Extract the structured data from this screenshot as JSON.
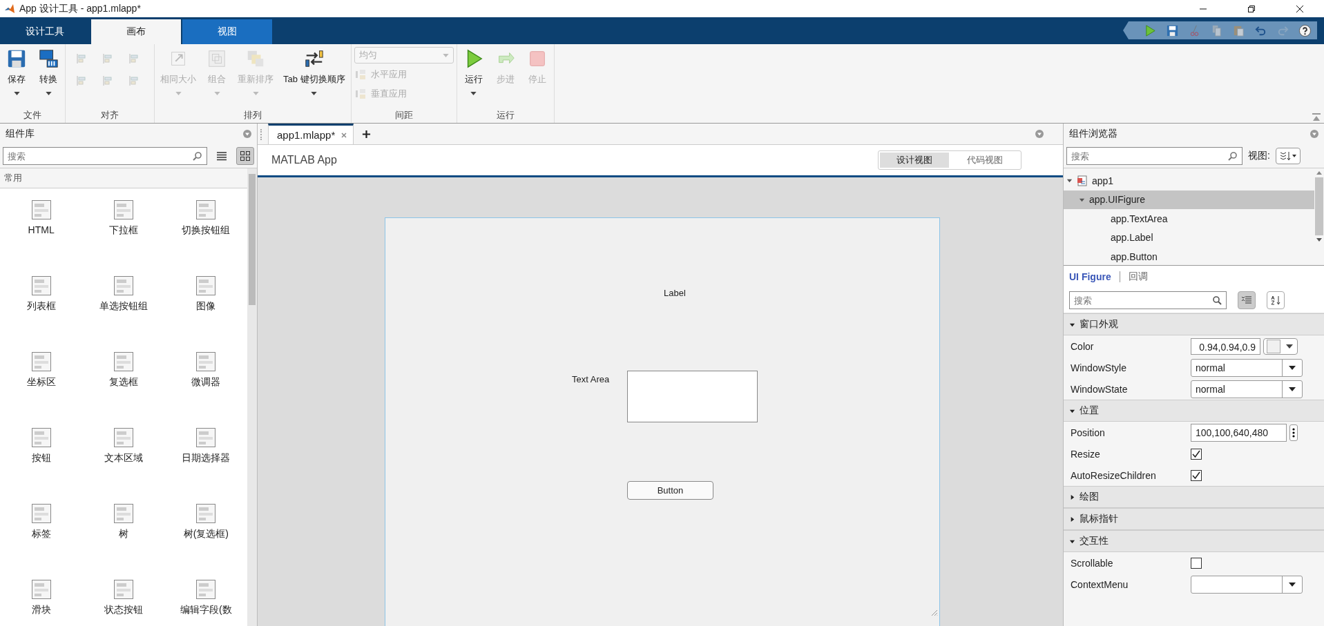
{
  "window": {
    "title": "App 设计工具 - app1.mlapp*"
  },
  "ribbon_tabs": [
    {
      "label": "设计工具",
      "selected": false
    },
    {
      "label": "画布",
      "selected": true
    },
    {
      "label": "视图",
      "selected": false
    }
  ],
  "ribbon_groups": [
    {
      "label": "文件",
      "items": [
        {
          "kind": "large",
          "label": "保存",
          "disabled": false,
          "dropdown": true
        },
        {
          "kind": "large",
          "label": "转换",
          "disabled": false,
          "dropdown": true
        }
      ]
    },
    {
      "label": "对齐",
      "items": [
        {
          "kind": "icon",
          "disabled": true
        },
        {
          "kind": "icon",
          "disabled": true
        },
        {
          "kind": "icon",
          "disabled": true
        },
        {
          "kind": "icon",
          "disabled": true
        },
        {
          "kind": "icon",
          "disabled": true
        },
        {
          "kind": "icon",
          "disabled": true
        }
      ]
    },
    {
      "label": "排列",
      "items": [
        {
          "kind": "large",
          "label": "相同大小",
          "disabled": true,
          "dropdown": true
        },
        {
          "kind": "large",
          "label": "组合",
          "disabled": true,
          "dropdown": true
        },
        {
          "kind": "large",
          "label": "重新排序",
          "disabled": true,
          "dropdown": true
        },
        {
          "kind": "large",
          "label": "Tab 键切换顺序",
          "disabled": false,
          "dropdown": true
        }
      ]
    },
    {
      "label": "间距",
      "items": [
        {
          "kind": "select",
          "value": "均匀",
          "disabled": true
        },
        {
          "kind": "small",
          "label": "水平应用",
          "disabled": true
        },
        {
          "kind": "small",
          "label": "垂直应用",
          "disabled": true
        }
      ]
    },
    {
      "label": "运行",
      "items": [
        {
          "kind": "large",
          "label": "运行",
          "disabled": false,
          "dropdown": true
        },
        {
          "kind": "large",
          "label": "步进",
          "disabled": true,
          "dropdown": false
        },
        {
          "kind": "large",
          "label": "停止",
          "disabled": true,
          "dropdown": false
        }
      ]
    }
  ],
  "library": {
    "title": "组件库",
    "search": {
      "placeholder": "搜索"
    },
    "view_modes": [
      {
        "kind": "list",
        "selected": false
      },
      {
        "kind": "grid",
        "selected": true
      }
    ],
    "section": "常用",
    "components": [
      "HTML",
      "下拉框",
      "切换按钮组",
      "列表框",
      "单选按钮组",
      "图像",
      "坐标区",
      "复选框",
      "微调器",
      "按钮",
      "文本区域",
      "日期选择器",
      "标签",
      "树",
      "树(复选框)",
      "滑块",
      "状态按钮",
      "编辑字段(数"
    ]
  },
  "document_tabs": [
    {
      "label": "app1.mlapp*",
      "selected": true
    }
  ],
  "designer": {
    "title": "MATLAB App",
    "views": [
      {
        "label": "设计视图",
        "selected": true
      },
      {
        "label": "代码视图",
        "selected": false
      }
    ]
  },
  "canvas": {
    "components": [
      {
        "kind": "label",
        "text": "Label"
      },
      {
        "kind": "textarea",
        "label": "Text Area"
      },
      {
        "kind": "button",
        "text": "Button"
      }
    ]
  },
  "browser": {
    "title": "组件浏览器",
    "search": {
      "placeholder": "搜索"
    },
    "view_label": "视图:",
    "tree": [
      {
        "label": "app1",
        "expanded": true,
        "selected": false,
        "children": [
          {
            "label": "app.UIFigure",
            "expanded": true,
            "selected": true,
            "children": [
              {
                "label": "app.TextArea",
                "selected": false
              },
              {
                "label": "app.Label",
                "selected": false
              },
              {
                "label": "app.Button",
                "selected": false
              }
            ]
          }
        ]
      }
    ]
  },
  "inspector": {
    "tabs": [
      {
        "label": "UI Figure",
        "selected": true
      },
      {
        "label": "回调",
        "selected": false
      }
    ],
    "search": {
      "placeholder": "搜索"
    },
    "sections": [
      {
        "title": "窗口外观",
        "expanded": true,
        "properties": [
          {
            "name": "Color",
            "kind": "color",
            "value": "0.94,0.94,0.9"
          },
          {
            "name": "WindowStyle",
            "kind": "dropdown",
            "value": "normal"
          },
          {
            "name": "WindowState",
            "kind": "dropdown",
            "value": "normal"
          }
        ]
      },
      {
        "title": "位置",
        "expanded": true,
        "properties": [
          {
            "name": "Position",
            "kind": "vector",
            "value": "100,100,640,480"
          },
          {
            "name": "Resize",
            "kind": "checkbox",
            "checked": true
          },
          {
            "name": "AutoResizeChildren",
            "kind": "checkbox",
            "checked": true
          }
        ]
      },
      {
        "title": "绘图",
        "expanded": false
      },
      {
        "title": "鼠标指针",
        "expanded": false
      },
      {
        "title": "交互性",
        "expanded": true,
        "properties": [
          {
            "name": "Scrollable",
            "kind": "checkbox",
            "checked": false
          },
          {
            "name": "ContextMenu",
            "kind": "dropdown"
          }
        ]
      }
    ]
  }
}
